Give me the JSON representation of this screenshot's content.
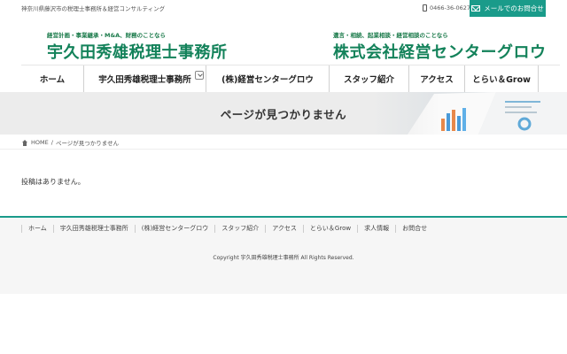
{
  "topbar": {
    "tagline": "神奈川県藤沢市の税理士事務所＆経営コンサルティング",
    "phone": "0466-36-0627",
    "mail_label": "メールでのお問合せ"
  },
  "logos": {
    "left": {
      "sub": "経営計画・事業継承・M&A、財務のことなら",
      "main": "宇久田秀雄税理士事務所"
    },
    "right": {
      "sub": "遺言・相続、起業相談・経営相談のことなら",
      "main": "株式会社経営センターグロウ"
    }
  },
  "nav": {
    "items": [
      {
        "label": "ホーム"
      },
      {
        "label": "宇久田秀雄税理士事務所"
      },
      {
        "label": "(株)経営センターグロウ"
      },
      {
        "label": "スタッフ紹介"
      },
      {
        "label": "アクセス"
      },
      {
        "label": "とらい＆Grow"
      }
    ]
  },
  "banner": {
    "title": "ページが見つかりません"
  },
  "breadcrumb": {
    "home": "HOME",
    "separator": "/",
    "current": "ページが見つかりません"
  },
  "content": {
    "message": "投稿はありません。"
  },
  "footer": {
    "links": [
      {
        "label": "ホーム"
      },
      {
        "label": "宇久田秀雄税理士事務所"
      },
      {
        "label": "(株)経営センターグロウ"
      },
      {
        "label": "スタッフ紹介"
      },
      {
        "label": "アクセス"
      },
      {
        "label": "とらい＆Grow"
      },
      {
        "label": "求人情報"
      },
      {
        "label": "お問合せ"
      }
    ],
    "copyright": "Copyright 宇久田秀雄税理士事務所 All Rights Reserved."
  },
  "colors": {
    "accent": "#1a9b8a",
    "logo_green": "#13825a"
  }
}
